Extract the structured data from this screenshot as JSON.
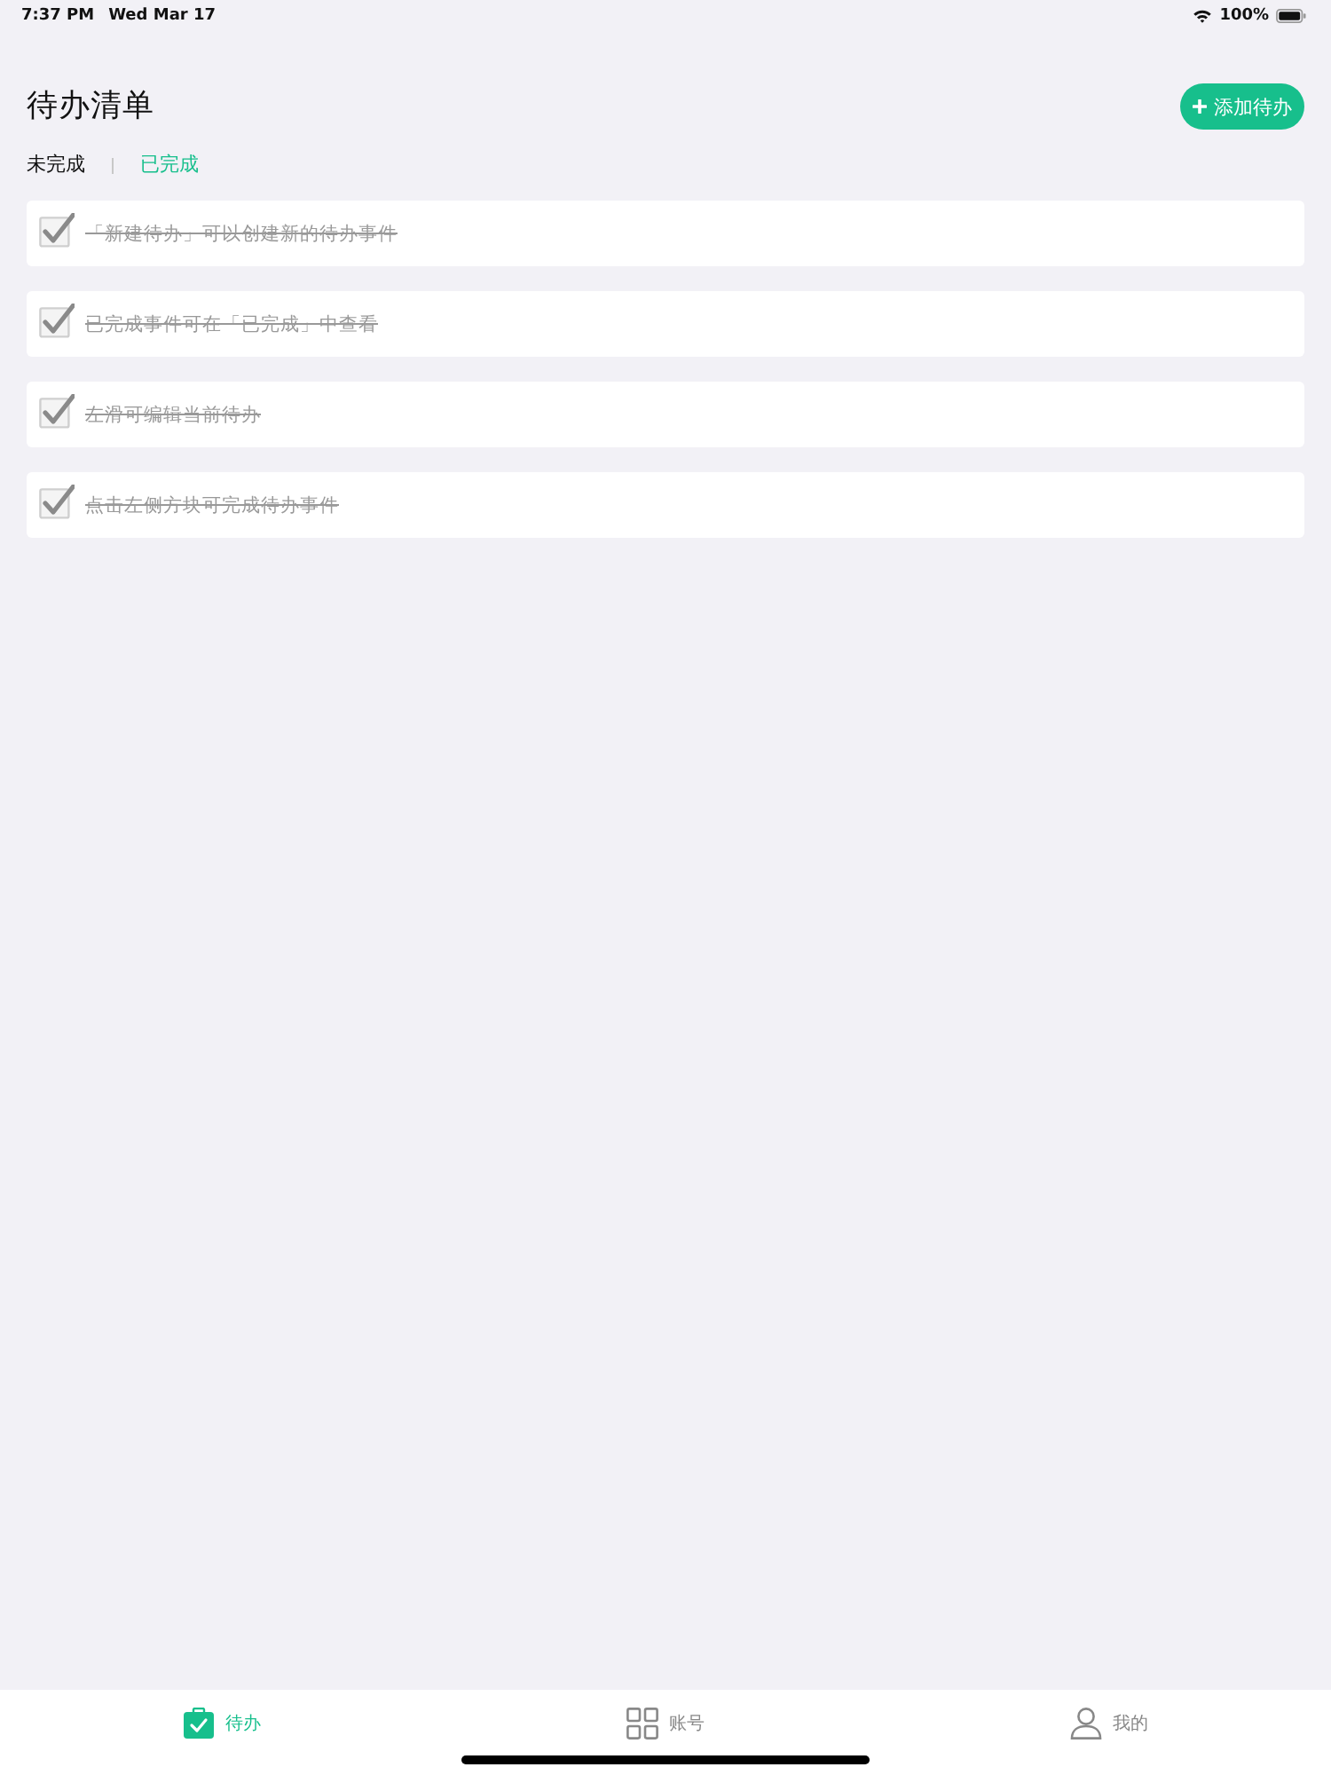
{
  "status_bar": {
    "time": "7:37 PM",
    "date": "Wed Mar 17",
    "battery": "100%"
  },
  "header": {
    "title": "待办清单",
    "add_button": "添加待办"
  },
  "filter_tabs": [
    {
      "label": "未完成",
      "selected": false
    },
    {
      "label": "已完成",
      "selected": true
    }
  ],
  "todos": [
    {
      "text": "「新建待办」可以创建新的待办事件",
      "checked": true
    },
    {
      "text": "已完成事件可在「已完成」中查看",
      "checked": true
    },
    {
      "text": "左滑可编辑当前待办",
      "checked": true
    },
    {
      "text": "点击左侧方块可完成待办事件",
      "checked": true
    }
  ],
  "tab_bar": [
    {
      "kind": "todo",
      "label": "待办",
      "selected": true
    },
    {
      "kind": "grid",
      "label": "账号",
      "selected": false
    },
    {
      "kind": "user",
      "label": "我的",
      "selected": false
    }
  ]
}
